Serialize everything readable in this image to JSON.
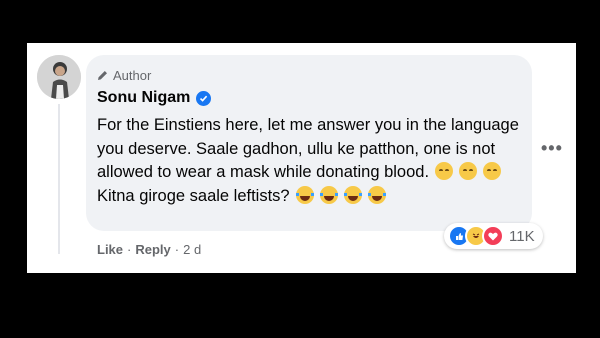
{
  "comment": {
    "author_badge": "Author",
    "name": "Sonu Nigam",
    "text_lines": [
      "For the Einstiens here, let me answer you in the language",
      "you deserve. Saale gadhon, ullu ke patthon, one is not",
      "allowed to wear a mask while donating blood.",
      "Kitna giroge saale leftists?"
    ],
    "line3_emojis": [
      "relieved-face",
      "relieved-face",
      "relieved-face"
    ],
    "line4_emojis": [
      "tears-of-joy-face",
      "tears-of-joy-face",
      "tears-of-joy-face",
      "tears-of-joy-face"
    ],
    "more_label": "•••",
    "actions": {
      "like": "Like",
      "reply": "Reply",
      "separator": "·",
      "time": "2 d"
    },
    "reactions": {
      "icons": [
        "like-icon",
        "haha-icon",
        "love-icon"
      ],
      "count": "11K"
    }
  },
  "colors": {
    "background": "#000000",
    "card": "#ffffff",
    "bubble": "#f0f2f5",
    "secondary_text": "#65676b",
    "verified": "#1877f2",
    "love": "#f33e58"
  }
}
